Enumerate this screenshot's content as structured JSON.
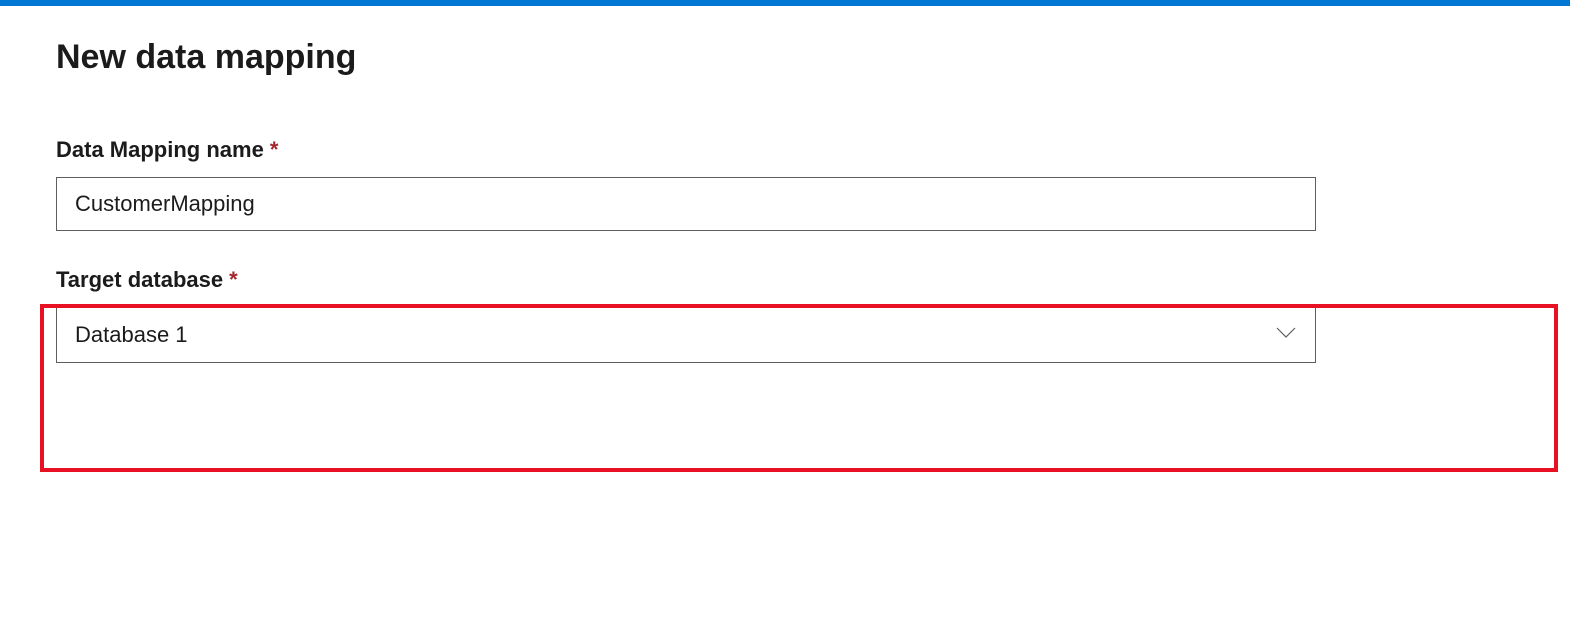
{
  "header": {
    "title": "New data mapping"
  },
  "fields": {
    "name": {
      "label": "Data Mapping name",
      "required_marker": "*",
      "value": "CustomerMapping"
    },
    "target_db": {
      "label": "Target database",
      "required_marker": "*",
      "selected": "Database 1"
    }
  },
  "colors": {
    "accent": "#0078d4",
    "highlight_border": "#e81123",
    "required": "#a4262c"
  }
}
